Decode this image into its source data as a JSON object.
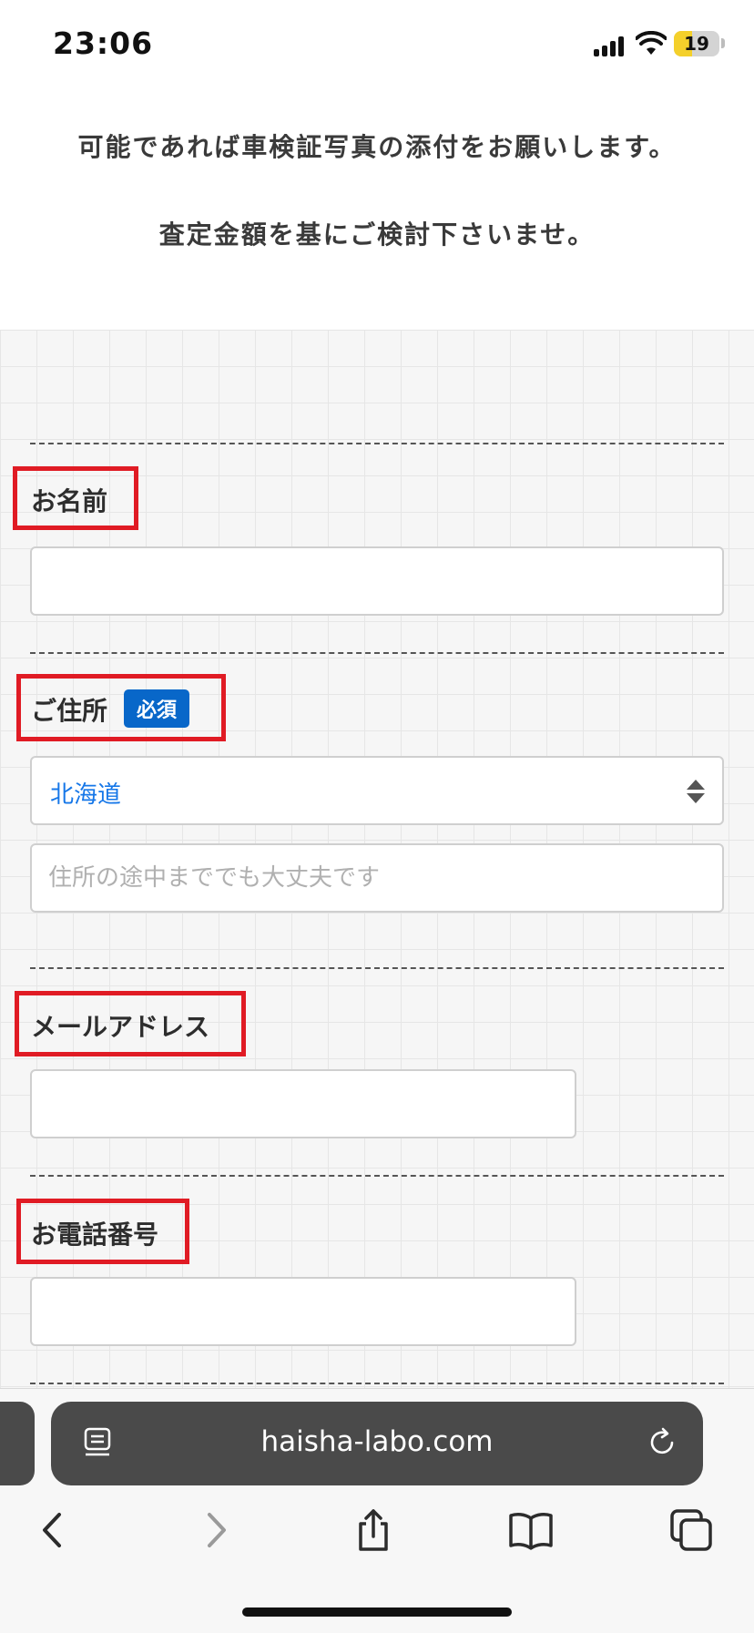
{
  "status_bar": {
    "time": "23:06",
    "battery": "19"
  },
  "intro": {
    "line1": "可能であれば車検証写真の添付をお願いします。",
    "line2": "査定金額を基にご検討下さいませ。"
  },
  "form": {
    "name": {
      "label": "お名前",
      "value": ""
    },
    "address": {
      "label": "ご住所",
      "required_badge": "必須",
      "prefecture": "北海道",
      "placeholder": "住所の途中まででも大丈夫です",
      "value": ""
    },
    "email": {
      "label": "メールアドレス",
      "value": ""
    },
    "phone": {
      "label": "お電話番号",
      "value": ""
    }
  },
  "browser": {
    "url": "haisha-labo.com"
  },
  "colors": {
    "highlight": "#e01b24",
    "badge": "#0867c9",
    "select_text": "#1677e8"
  }
}
